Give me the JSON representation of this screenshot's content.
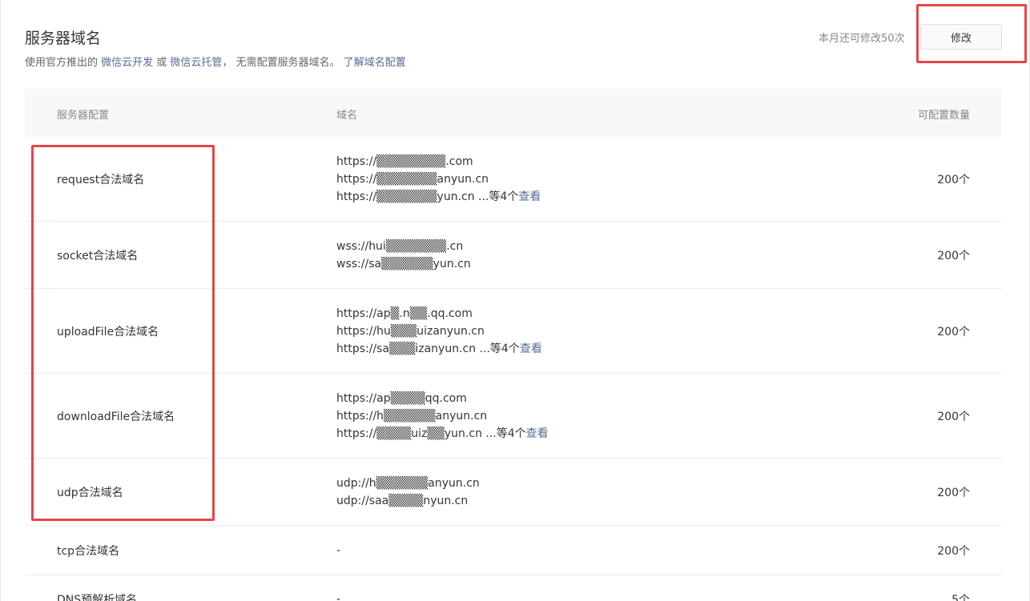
{
  "header": {
    "title": "服务器域名",
    "desc_prefix": "使用官方推出的 ",
    "link_cloud_dev": "微信云开发",
    "desc_or": " 或 ",
    "link_cloud_hosting": "微信云托管",
    "desc_suffix": "， 无需配置服务器域名。 ",
    "link_learn": "了解域名配置",
    "quota_text": "本月还可修改50次",
    "edit_label": "修改"
  },
  "table": {
    "columns": [
      "服务器配置",
      "域名",
      "可配置数量"
    ],
    "rows": [
      {
        "name": "request合法域名",
        "domains": [
          "https://▒▒▒▒▒▒▒▒.com",
          "https://▒▒▒▒▒▒▒anyun.cn",
          "https://▒▒▒▒▒▒▒yun.cn"
        ],
        "more_prefix": " ...等4个",
        "more_link": "查看",
        "count": "200个"
      },
      {
        "name": "socket合法域名",
        "domains": [
          "wss://hui▒▒▒▒▒▒▒.cn",
          "wss://sa▒▒▒▒▒▒yun.cn"
        ],
        "more_prefix": "",
        "more_link": "",
        "count": "200个"
      },
      {
        "name": "uploadFile合法域名",
        "domains": [
          "https://ap▒.n▒▒.qq.com",
          "https://hu▒▒▒uizanyun.cn",
          "https://sa▒▒▒izanyun.cn"
        ],
        "more_prefix": " ...等4个",
        "more_link": "查看",
        "count": "200个"
      },
      {
        "name": "downloadFile合法域名",
        "domains": [
          "https://ap▒▒▒▒qq.com",
          "https://h▒▒▒▒▒▒anyun.cn",
          "https://▒▒▒▒uiz▒▒yun.cn"
        ],
        "more_prefix": " ...等4个",
        "more_link": "查看",
        "count": "200个"
      },
      {
        "name": "udp合法域名",
        "domains": [
          "udp://h▒▒▒▒▒▒anyun.cn",
          "udp://saa▒▒▒▒nyun.cn"
        ],
        "more_prefix": "",
        "more_link": "",
        "count": "200个"
      },
      {
        "name": "tcp合法域名",
        "domains": [
          "-"
        ],
        "more_prefix": "",
        "more_link": "",
        "count": "200个"
      },
      {
        "name": "DNS预解析域名",
        "domains": [
          "-"
        ],
        "more_prefix": "",
        "more_link": "",
        "count": "5个"
      }
    ]
  },
  "colors": {
    "highlight": "#e8454a",
    "link": "#576b95"
  }
}
